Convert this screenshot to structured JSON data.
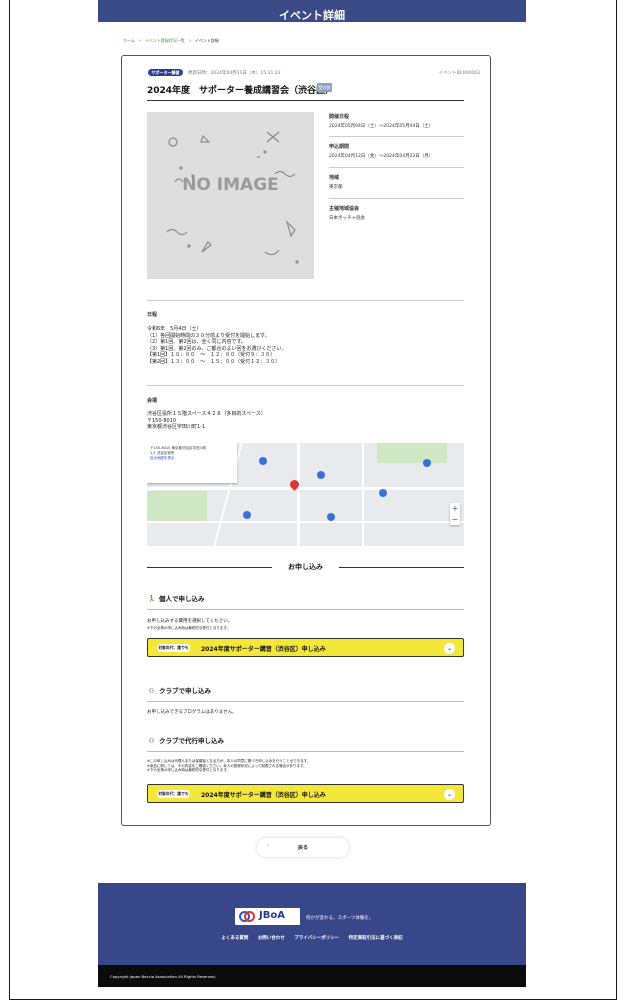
{
  "header": {
    "page_title": "イベント詳細"
  },
  "breadcrumb": [
    {
      "label": "ホーム"
    },
    {
      "label": "イベント登録状況一覧"
    },
    {
      "label": "イベント詳細"
    }
  ],
  "breadcrumb_sep": ">",
  "event": {
    "status_pill": "サポーター講習",
    "updated": "更新日時：2024年04月11日（木）15:11:22",
    "event_id": "イベントID:000003",
    "title": "2024年度　サポーター養成講習会（渋谷区）",
    "badge": "受付前",
    "no_image_text": "NO IMAGE",
    "info": [
      {
        "label": "開催日程",
        "value": "2024年05月04日（土）〜2024年05月04日（土）"
      },
      {
        "label": "申込期間",
        "value": "2024年04月12日（金）〜2024年04月22日（月）"
      },
      {
        "label": "地域",
        "value": "東京都"
      },
      {
        "label": "主催地域協会",
        "value": "日本ボッチャ協会"
      }
    ],
    "schedule_label": "日程",
    "schedule_lines": [
      "令和6年　5月4日（土）",
      "（1）各回開始時間の３０分前より受付を開始します。",
      "（2）第1回、第2回は、全く同じ内容です。",
      "（3）第1回、第2回のみ、ご都合のよい回をお選びください。",
      "【第1回】１０：００　〜　１２：００（受付９：３０）",
      "【第2回】１３：００　〜　１５：００（受付１２：３０）"
    ],
    "venue_label": "会場",
    "venue_lines": [
      "渋谷区役所１５階スペース４２８（多目的スペース）",
      "〒150-8010",
      "東京都渋谷区宇田川町1-1"
    ]
  },
  "map": {
    "info_lines": [
      "〒150-8010 東京都渋谷区宇田川町",
      "1-1 渋谷区役所"
    ],
    "info_link": "拡大地図を表示",
    "zoom_in": "+",
    "zoom_out": "−"
  },
  "apply": {
    "heading": "お申し込み",
    "individual": {
      "title": "個人で申し込み",
      "note1": "お申し込みする費用を選択してください。",
      "note2": "※下の全角の申し込み時は最終的な受付となります。",
      "target": "対象年代：誰でも",
      "button": "2024年度サポーター講習（渋谷区）申し込み"
    },
    "club": {
      "title": "クラブで申し込み",
      "note": "お申し込みできるプログラムはありません。"
    },
    "proxy": {
      "title": "クラブで代行申し込み",
      "notes": [
        "※この申し込みは代理人または保護者となる方が、本人の同意に基づき申し込みを行うことができます。",
        "※参加に際しては、その内容をご確認ください。本人の登録状況によって制限される場合があります。",
        "※下の全角の申し込み時は最終的な受付となります。"
      ],
      "target": "対象年代：誰でも",
      "button": "2024年度サポーター講習（渋谷区）申し込み"
    },
    "chevron": "⌄"
  },
  "back": {
    "label": "戻る",
    "arrow": "‹"
  },
  "footer": {
    "logo": "JBoA",
    "tagline": "何かが変わる。スポーツ体験を。",
    "links": [
      "よくある質問",
      "お問い合わせ",
      "プライバシーポリシー",
      "特定商取引法に基づく表記"
    ],
    "copyright": "Copyright Japan Boccia Association All Rights Reserved."
  }
}
